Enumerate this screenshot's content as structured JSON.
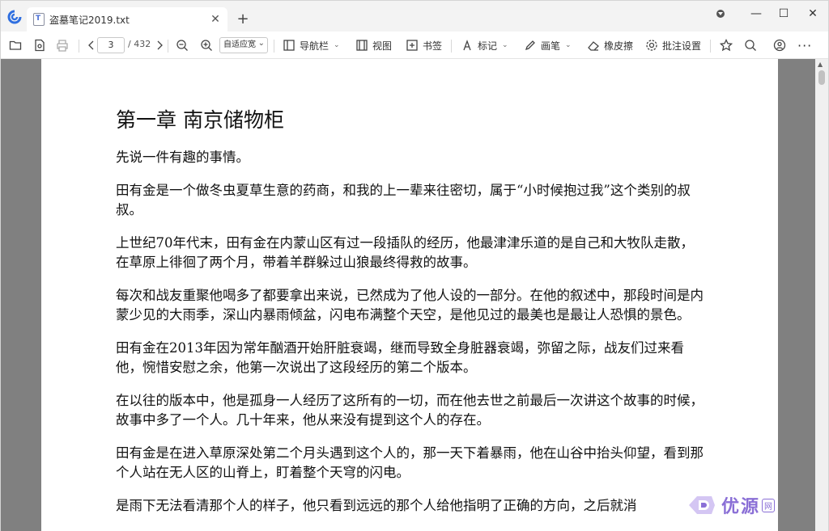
{
  "tab": {
    "title": "盗墓笔记2019.txt"
  },
  "toolbar": {
    "page_current": "3",
    "page_total": "/ 432",
    "zoom": "自适应宽",
    "navigation": "导航栏",
    "view": "视图",
    "bookmark": "书签",
    "mark": "标记",
    "pen": "画笔",
    "eraser": "橡皮擦",
    "annotation_settings": "批注设置"
  },
  "document": {
    "chapter_title": "第一章 南京储物柜",
    "paragraphs": [
      "先说一件有趣的事情。",
      "田有金是一个做冬虫夏草生意的药商，和我的上一辈来往密切，属于“小时候抱过我”这个类别的叔叔。",
      "上世纪70年代末，田有金在内蒙山区有过一段插队的经历，他最津津乐道的是自己和大牧队走散，在草原上徘徊了两个月，带着羊群躲过山狼最终得救的故事。",
      "每次和战友重聚他喝多了都要拿出来说，已然成为了他人设的一部分。在他的叙述中，那段时间是内蒙少见的大雨季，深山内暴雨倾盆，闪电布满整个天空，是他见过的最美也是最让人恐惧的景色。",
      "田有金在2013年因为常年酗酒开始肝脏衰竭，继而导致全身脏器衰竭，弥留之际，战友们过来看他，惋惜安慰之余，他第一次说出了这段经历的第二个版本。",
      "在以往的版本中，他是孤身一人经历了这所有的一切，而在他去世之前最后一次讲这个故事的时候，故事中多了一个人。几十年来，他从来没有提到这个人的存在。",
      "田有金是在进入草原深处第二个月头遇到这个人的，那一天下着暴雨，他在山谷中抬头仰望，看到那个人站在无人区的山脊上，盯着整个天穹的闪电。",
      "是雨下无法看清那个人的样子，他只看到远远的那个人给他指明了正确的方向，之后就消"
    ]
  },
  "watermark": {
    "text": "优源",
    "net": "网"
  }
}
